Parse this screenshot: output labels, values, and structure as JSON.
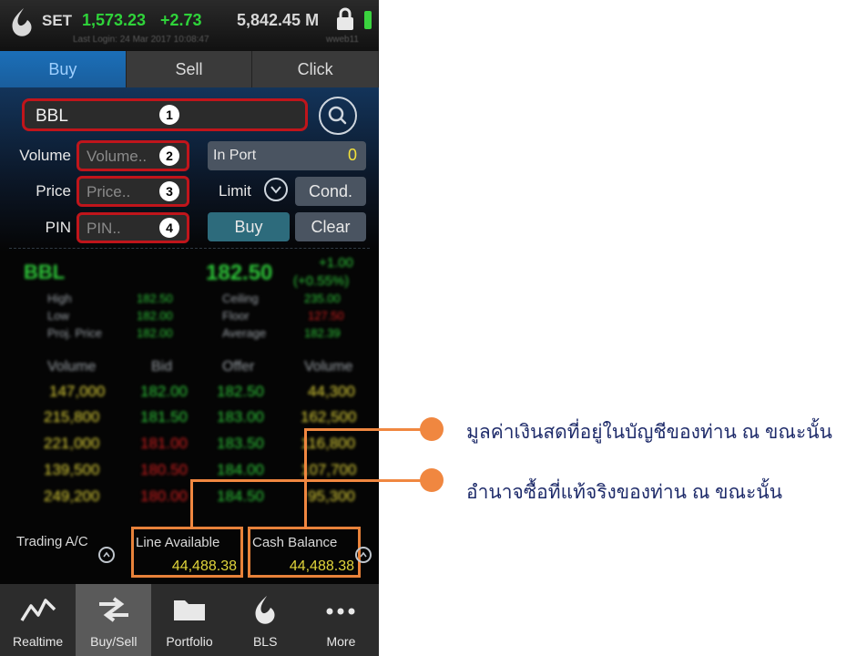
{
  "status": {
    "market": "SET",
    "index": "1,573.23",
    "change": "+2.73",
    "value": "5,842.45 M",
    "last_login": "Last Login: 24 Mar 2017 10:08:47",
    "user": "wweb11"
  },
  "tabs": [
    "Buy",
    "Sell",
    "Click"
  ],
  "form": {
    "symbol": "BBL",
    "volume_label": "Volume",
    "volume_placeholder": "Volume..",
    "price_label": "Price",
    "price_placeholder": "Price..",
    "pin_label": "PIN",
    "pin_placeholder": "PIN..",
    "inport_label": "In Port",
    "inport_value": "0",
    "limit_label": "Limit",
    "cond_label": "Cond.",
    "buy_label": "Buy",
    "clear_label": "Clear",
    "markers": [
      "1",
      "2",
      "3",
      "4"
    ]
  },
  "quote": {
    "symbol": "BBL",
    "last": "182.50",
    "change": "+1.00",
    "pct_change": "(+0.55%)",
    "high_label": "High",
    "high": "182.50",
    "low_label": "Low",
    "low": "182.00",
    "proj_label": "Proj. Price",
    "proj": "182.00",
    "ceiling_label": "Ceiling",
    "ceiling": "235.00",
    "floor_label": "Floor",
    "floor": "127.50",
    "average_label": "Average",
    "average": "182.39"
  },
  "book": {
    "headers": [
      "Volume",
      "Bid",
      "Offer",
      "Volume"
    ],
    "rows": [
      [
        "147,000",
        "182.00",
        "182.50",
        "44,300"
      ],
      [
        "215,800",
        "181.50",
        "183.00",
        "162,500"
      ],
      [
        "221,000",
        "181.00",
        "183.50",
        "116,800"
      ],
      [
        "139,500",
        "180.50",
        "184.00",
        "107,700"
      ],
      [
        "249,200",
        "180.00",
        "184.50",
        "95,300"
      ]
    ]
  },
  "account": {
    "trading_label": "Trading A/C",
    "line_label": "Line Available",
    "line_value": "44,488.38",
    "cash_label": "Cash Balance",
    "cash_value": "44,488.38"
  },
  "nav": [
    {
      "label": "Realtime",
      "icon": "realtime-chart-icon"
    },
    {
      "label": "Buy/Sell",
      "icon": "buy-sell-arrows-icon"
    },
    {
      "label": "Portfolio",
      "icon": "folder-icon"
    },
    {
      "label": "BLS",
      "icon": "bls-logo-icon"
    },
    {
      "label": "More",
      "icon": "more-dots-icon"
    }
  ],
  "annotations": {
    "cash_note": "มูลค่าเงินสดที่อยู่ในบัญชีของท่าน ณ ขณะนั้น",
    "line_note": "อำนาจซื้อที่แท้จริงของท่าน ณ ขณะนั้น"
  },
  "colors": {
    "highlight_red": "#c0151b",
    "callout_orange": "#f08740",
    "up_green": "#2fc93a",
    "down_red": "#d11e1e",
    "value_yellow": "#e0d43a",
    "active_tab": "#1b6fb8"
  }
}
